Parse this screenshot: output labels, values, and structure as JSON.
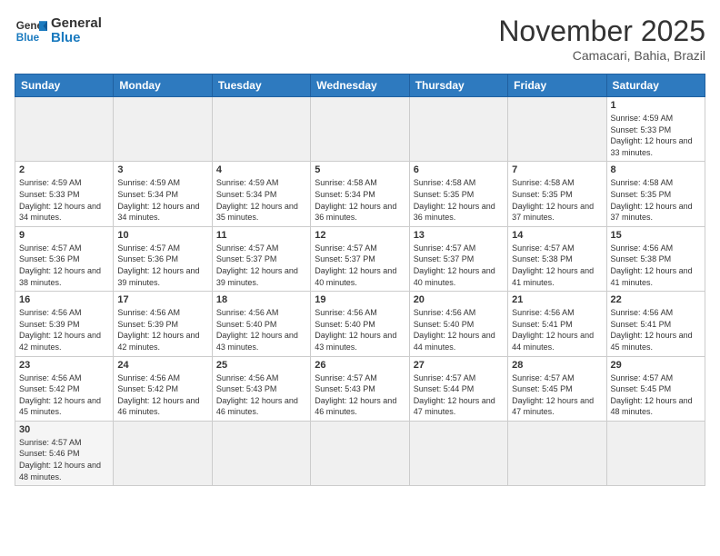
{
  "logo": {
    "general": "General",
    "blue": "Blue"
  },
  "header": {
    "month_year": "November 2025",
    "location": "Camacari, Bahia, Brazil"
  },
  "weekdays": [
    "Sunday",
    "Monday",
    "Tuesday",
    "Wednesday",
    "Thursday",
    "Friday",
    "Saturday"
  ],
  "weeks": [
    [
      {
        "day": "",
        "empty": true
      },
      {
        "day": "",
        "empty": true
      },
      {
        "day": "",
        "empty": true
      },
      {
        "day": "",
        "empty": true
      },
      {
        "day": "",
        "empty": true
      },
      {
        "day": "",
        "empty": true
      },
      {
        "day": "1",
        "sunrise": "4:59 AM",
        "sunset": "5:33 PM",
        "daylight": "12 hours and 33 minutes."
      }
    ],
    [
      {
        "day": "2",
        "sunrise": "4:59 AM",
        "sunset": "5:33 PM",
        "daylight": "12 hours and 34 minutes."
      },
      {
        "day": "3",
        "sunrise": "4:59 AM",
        "sunset": "5:34 PM",
        "daylight": "12 hours and 34 minutes."
      },
      {
        "day": "4",
        "sunrise": "4:59 AM",
        "sunset": "5:34 PM",
        "daylight": "12 hours and 35 minutes."
      },
      {
        "day": "5",
        "sunrise": "4:58 AM",
        "sunset": "5:34 PM",
        "daylight": "12 hours and 36 minutes."
      },
      {
        "day": "6",
        "sunrise": "4:58 AM",
        "sunset": "5:35 PM",
        "daylight": "12 hours and 36 minutes."
      },
      {
        "day": "7",
        "sunrise": "4:58 AM",
        "sunset": "5:35 PM",
        "daylight": "12 hours and 37 minutes."
      },
      {
        "day": "8",
        "sunrise": "4:58 AM",
        "sunset": "5:35 PM",
        "daylight": "12 hours and 37 minutes."
      }
    ],
    [
      {
        "day": "9",
        "sunrise": "4:57 AM",
        "sunset": "5:36 PM",
        "daylight": "12 hours and 38 minutes."
      },
      {
        "day": "10",
        "sunrise": "4:57 AM",
        "sunset": "5:36 PM",
        "daylight": "12 hours and 39 minutes."
      },
      {
        "day": "11",
        "sunrise": "4:57 AM",
        "sunset": "5:37 PM",
        "daylight": "12 hours and 39 minutes."
      },
      {
        "day": "12",
        "sunrise": "4:57 AM",
        "sunset": "5:37 PM",
        "daylight": "12 hours and 40 minutes."
      },
      {
        "day": "13",
        "sunrise": "4:57 AM",
        "sunset": "5:37 PM",
        "daylight": "12 hours and 40 minutes."
      },
      {
        "day": "14",
        "sunrise": "4:57 AM",
        "sunset": "5:38 PM",
        "daylight": "12 hours and 41 minutes."
      },
      {
        "day": "15",
        "sunrise": "4:56 AM",
        "sunset": "5:38 PM",
        "daylight": "12 hours and 41 minutes."
      }
    ],
    [
      {
        "day": "16",
        "sunrise": "4:56 AM",
        "sunset": "5:39 PM",
        "daylight": "12 hours and 42 minutes."
      },
      {
        "day": "17",
        "sunrise": "4:56 AM",
        "sunset": "5:39 PM",
        "daylight": "12 hours and 42 minutes."
      },
      {
        "day": "18",
        "sunrise": "4:56 AM",
        "sunset": "5:40 PM",
        "daylight": "12 hours and 43 minutes."
      },
      {
        "day": "19",
        "sunrise": "4:56 AM",
        "sunset": "5:40 PM",
        "daylight": "12 hours and 43 minutes."
      },
      {
        "day": "20",
        "sunrise": "4:56 AM",
        "sunset": "5:40 PM",
        "daylight": "12 hours and 44 minutes."
      },
      {
        "day": "21",
        "sunrise": "4:56 AM",
        "sunset": "5:41 PM",
        "daylight": "12 hours and 44 minutes."
      },
      {
        "day": "22",
        "sunrise": "4:56 AM",
        "sunset": "5:41 PM",
        "daylight": "12 hours and 45 minutes."
      }
    ],
    [
      {
        "day": "23",
        "sunrise": "4:56 AM",
        "sunset": "5:42 PM",
        "daylight": "12 hours and 45 minutes."
      },
      {
        "day": "24",
        "sunrise": "4:56 AM",
        "sunset": "5:42 PM",
        "daylight": "12 hours and 46 minutes."
      },
      {
        "day": "25",
        "sunrise": "4:56 AM",
        "sunset": "5:43 PM",
        "daylight": "12 hours and 46 minutes."
      },
      {
        "day": "26",
        "sunrise": "4:57 AM",
        "sunset": "5:43 PM",
        "daylight": "12 hours and 46 minutes."
      },
      {
        "day": "27",
        "sunrise": "4:57 AM",
        "sunset": "5:44 PM",
        "daylight": "12 hours and 47 minutes."
      },
      {
        "day": "28",
        "sunrise": "4:57 AM",
        "sunset": "5:45 PM",
        "daylight": "12 hours and 47 minutes."
      },
      {
        "day": "29",
        "sunrise": "4:57 AM",
        "sunset": "5:45 PM",
        "daylight": "12 hours and 48 minutes."
      }
    ],
    [
      {
        "day": "30",
        "sunrise": "4:57 AM",
        "sunset": "5:46 PM",
        "daylight": "12 hours and 48 minutes."
      },
      {
        "day": "",
        "empty": true
      },
      {
        "day": "",
        "empty": true
      },
      {
        "day": "",
        "empty": true
      },
      {
        "day": "",
        "empty": true
      },
      {
        "day": "",
        "empty": true
      },
      {
        "day": "",
        "empty": true
      }
    ]
  ]
}
